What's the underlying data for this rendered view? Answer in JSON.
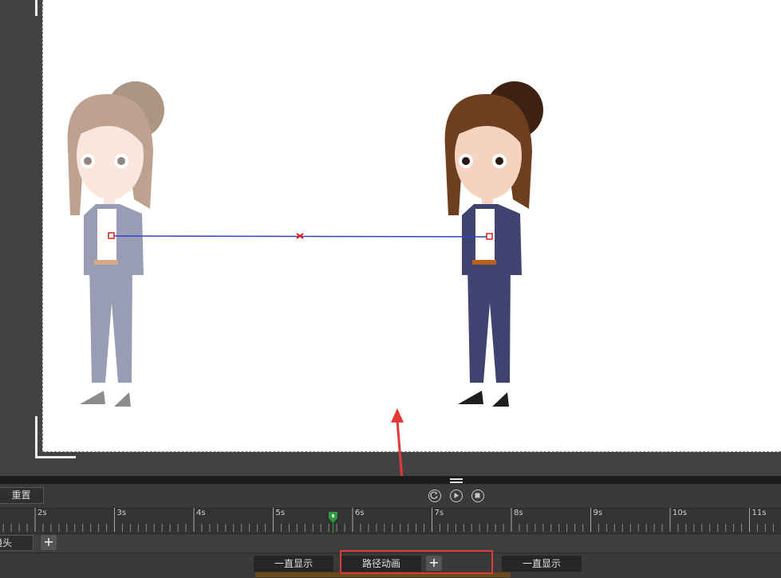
{
  "toolbar": {
    "reset_label": "重置",
    "controls": [
      "refresh-icon",
      "play-icon",
      "stop-icon"
    ]
  },
  "timeline": {
    "ticks": [
      "2s",
      "3s",
      "4s",
      "5s",
      "6s",
      "7s",
      "8s",
      "9s",
      "10s",
      "11s"
    ]
  },
  "tracks": {
    "camera_label": "镜头",
    "add_label": "+",
    "blocks": {
      "always_show_left": "一直显示",
      "path_animation": "路径动画",
      "always_show_right": "一直显示"
    }
  },
  "colors": {
    "highlight": "#e53935",
    "path_line": "#2a45c9",
    "playhead": "#2e9c3e"
  }
}
